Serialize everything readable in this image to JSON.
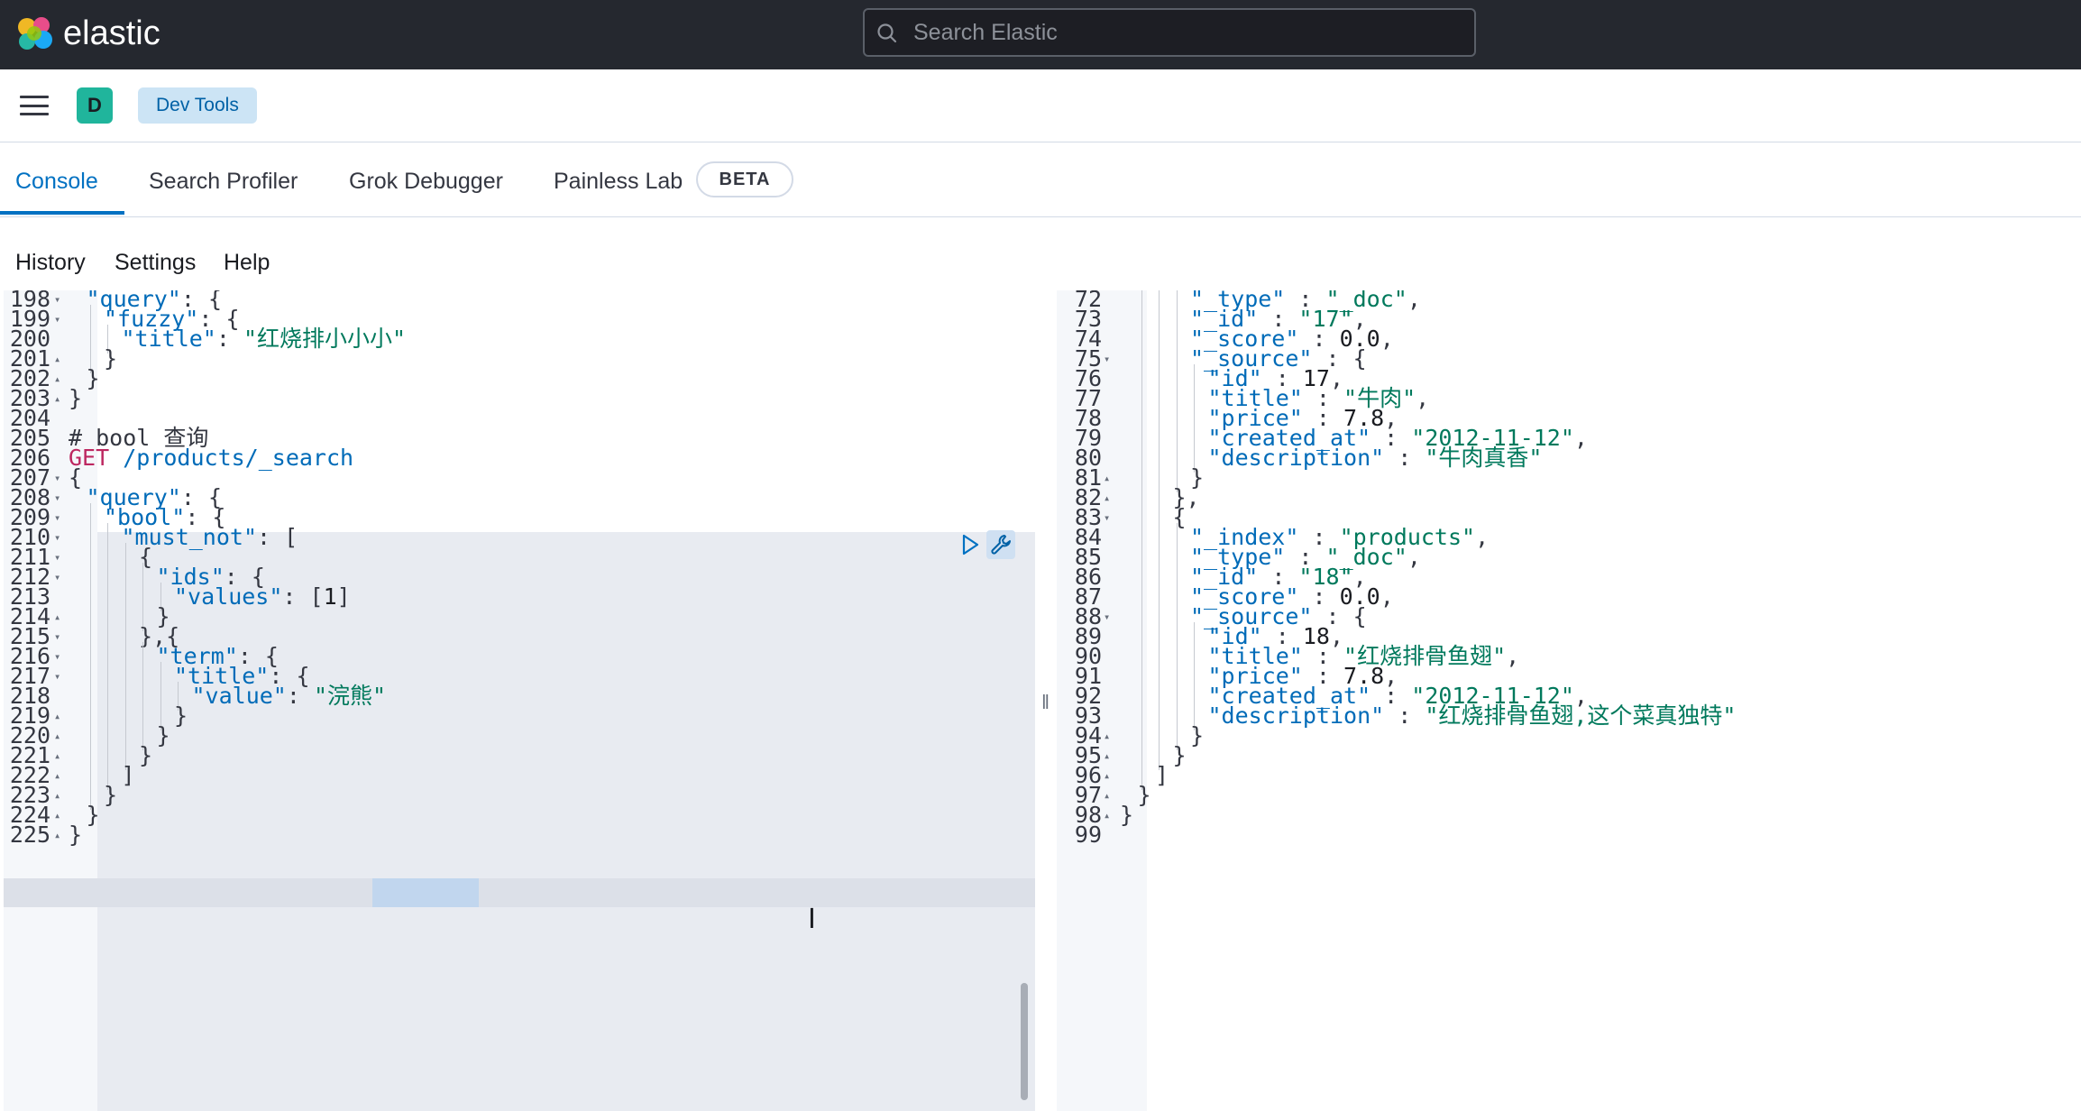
{
  "app": {
    "brand": "elastic",
    "search_placeholder": "Search Elastic"
  },
  "header": {
    "avatar_letter": "D",
    "breadcrumb": "Dev Tools"
  },
  "tabs": [
    {
      "label": "Console",
      "active": true
    },
    {
      "label": "Search Profiler"
    },
    {
      "label": "Grok Debugger"
    },
    {
      "label": "Painless Lab"
    }
  ],
  "beta_badge": "BETA",
  "menu": [
    "History",
    "Settings",
    "Help"
  ],
  "editor": {
    "lines": [
      {
        "n": "198",
        "fold": "down",
        "indent": 1,
        "parts": [
          [
            "k",
            "\"query\""
          ],
          [
            "p",
            ": {"
          ]
        ]
      },
      {
        "n": "199",
        "fold": "down",
        "indent": 2,
        "parts": [
          [
            "k",
            "\"fuzzy\""
          ],
          [
            "p",
            ": {"
          ]
        ]
      },
      {
        "n": "200",
        "indent": 3,
        "parts": [
          [
            "k",
            "\"title\""
          ],
          [
            "p",
            ": "
          ],
          [
            "s",
            "\"红烧排小小小\""
          ]
        ]
      },
      {
        "n": "201",
        "fold": "up",
        "indent": 2,
        "parts": [
          [
            "p",
            "}"
          ]
        ]
      },
      {
        "n": "202",
        "fold": "up",
        "indent": 1,
        "parts": [
          [
            "p",
            "}"
          ]
        ]
      },
      {
        "n": "203",
        "fold": "up",
        "indent": 0,
        "parts": [
          [
            "p",
            "}"
          ]
        ]
      },
      {
        "n": "204",
        "indent": 0,
        "parts": []
      },
      {
        "n": "205",
        "indent": 0,
        "parts": [
          [
            "c",
            "# bool 查询"
          ]
        ]
      },
      {
        "n": "206",
        "indent": 0,
        "parts": [
          [
            "m",
            "GET"
          ],
          [
            "p",
            " "
          ],
          [
            "k",
            "/products/_search"
          ]
        ]
      },
      {
        "n": "207",
        "fold": "down",
        "indent": 0,
        "parts": [
          [
            "p",
            "{"
          ]
        ]
      },
      {
        "n": "208",
        "fold": "down",
        "indent": 1,
        "parts": [
          [
            "k",
            "\"query\""
          ],
          [
            "p",
            ": {"
          ]
        ]
      },
      {
        "n": "209",
        "fold": "down",
        "indent": 2,
        "parts": [
          [
            "k",
            "\"bool\""
          ],
          [
            "p",
            ": {"
          ]
        ]
      },
      {
        "n": "210",
        "fold": "down",
        "indent": 3,
        "parts": [
          [
            "k",
            "\"must_not\""
          ],
          [
            "p",
            ": ["
          ]
        ]
      },
      {
        "n": "211",
        "fold": "down",
        "indent": 4,
        "parts": [
          [
            "p",
            "{"
          ]
        ]
      },
      {
        "n": "212",
        "fold": "down",
        "indent": 5,
        "parts": [
          [
            "k",
            "\"ids\""
          ],
          [
            "p",
            ": {"
          ]
        ]
      },
      {
        "n": "213",
        "indent": 6,
        "parts": [
          [
            "k",
            "\"values\""
          ],
          [
            "p",
            ": ["
          ],
          [
            "n",
            "1"
          ],
          [
            "p",
            "]"
          ]
        ]
      },
      {
        "n": "214",
        "fold": "up",
        "indent": 5,
        "parts": [
          [
            "p",
            "}"
          ]
        ]
      },
      {
        "n": "215",
        "fold": "down",
        "indent": 4,
        "parts": [
          [
            "p",
            "},{"
          ]
        ]
      },
      {
        "n": "216",
        "fold": "down",
        "indent": 5,
        "parts": [
          [
            "k",
            "\"term\""
          ],
          [
            "p",
            ": {"
          ]
        ]
      },
      {
        "n": "217",
        "fold": "down",
        "indent": 6,
        "parts": [
          [
            "k",
            "\"title\""
          ],
          [
            "p",
            ": {"
          ]
        ]
      },
      {
        "n": "218",
        "indent": 7,
        "parts": [
          [
            "k",
            "\"value\""
          ],
          [
            "p",
            ": "
          ],
          [
            "s",
            "\"浣熊\""
          ]
        ]
      },
      {
        "n": "219",
        "fold": "up",
        "indent": 6,
        "parts": [
          [
            "p",
            "}"
          ]
        ]
      },
      {
        "n": "220",
        "fold": "up",
        "indent": 5,
        "parts": [
          [
            "p",
            "}"
          ]
        ]
      },
      {
        "n": "221",
        "fold": "up",
        "indent": 4,
        "parts": [
          [
            "p",
            "}"
          ]
        ]
      },
      {
        "n": "222",
        "fold": "up",
        "indent": 3,
        "parts": [
          [
            "p",
            "]"
          ]
        ]
      },
      {
        "n": "223",
        "fold": "up",
        "indent": 2,
        "parts": [
          [
            "p",
            "}"
          ]
        ]
      },
      {
        "n": "224",
        "fold": "up",
        "indent": 1,
        "parts": [
          [
            "p",
            "}"
          ]
        ]
      },
      {
        "n": "225",
        "fold": "up",
        "indent": 0,
        "parts": [
          [
            "p",
            "}"
          ]
        ]
      }
    ]
  },
  "output": {
    "lines": [
      {
        "n": "72",
        "indent": 4,
        "parts": [
          [
            "k",
            "\"_type\""
          ],
          [
            "p",
            " : "
          ],
          [
            "s",
            "\"_doc\""
          ],
          [
            "p",
            ","
          ]
        ]
      },
      {
        "n": "73",
        "indent": 4,
        "parts": [
          [
            "k",
            "\"_id\""
          ],
          [
            "p",
            " : "
          ],
          [
            "s",
            "\"17\""
          ],
          [
            "p",
            ","
          ]
        ]
      },
      {
        "n": "74",
        "indent": 4,
        "parts": [
          [
            "k",
            "\"_score\""
          ],
          [
            "p",
            " : "
          ],
          [
            "n",
            "0.0"
          ],
          [
            "p",
            ","
          ]
        ]
      },
      {
        "n": "75",
        "fold": "down",
        "indent": 4,
        "parts": [
          [
            "k",
            "\"_source\""
          ],
          [
            "p",
            " : {"
          ]
        ]
      },
      {
        "n": "76",
        "indent": 5,
        "parts": [
          [
            "k",
            "\"id\""
          ],
          [
            "p",
            " : "
          ],
          [
            "n",
            "17"
          ],
          [
            "p",
            ","
          ]
        ]
      },
      {
        "n": "77",
        "indent": 5,
        "parts": [
          [
            "k",
            "\"title\""
          ],
          [
            "p",
            " : "
          ],
          [
            "s",
            "\"牛肉\""
          ],
          [
            "p",
            ","
          ]
        ]
      },
      {
        "n": "78",
        "indent": 5,
        "parts": [
          [
            "k",
            "\"price\""
          ],
          [
            "p",
            " : "
          ],
          [
            "n",
            "7.8"
          ],
          [
            "p",
            ","
          ]
        ]
      },
      {
        "n": "79",
        "indent": 5,
        "parts": [
          [
            "k",
            "\"created_at\""
          ],
          [
            "p",
            " : "
          ],
          [
            "s",
            "\"2012-11-12\""
          ],
          [
            "p",
            ","
          ]
        ]
      },
      {
        "n": "80",
        "indent": 5,
        "parts": [
          [
            "k",
            "\"description\""
          ],
          [
            "p",
            " : "
          ],
          [
            "s",
            "\"牛肉真香\""
          ]
        ]
      },
      {
        "n": "81",
        "fold": "up",
        "indent": 4,
        "parts": [
          [
            "p",
            "}"
          ]
        ]
      },
      {
        "n": "82",
        "fold": "up",
        "indent": 3,
        "parts": [
          [
            "p",
            "},"
          ]
        ]
      },
      {
        "n": "83",
        "fold": "down",
        "indent": 3,
        "parts": [
          [
            "p",
            "{"
          ]
        ]
      },
      {
        "n": "84",
        "indent": 4,
        "parts": [
          [
            "k",
            "\"_index\""
          ],
          [
            "p",
            " : "
          ],
          [
            "s",
            "\"products\""
          ],
          [
            "p",
            ","
          ]
        ]
      },
      {
        "n": "85",
        "indent": 4,
        "parts": [
          [
            "k",
            "\"_type\""
          ],
          [
            "p",
            " : "
          ],
          [
            "s",
            "\"_doc\""
          ],
          [
            "p",
            ","
          ]
        ]
      },
      {
        "n": "86",
        "indent": 4,
        "parts": [
          [
            "k",
            "\"_id\""
          ],
          [
            "p",
            " : "
          ],
          [
            "s",
            "\"18\""
          ],
          [
            "p",
            ","
          ]
        ]
      },
      {
        "n": "87",
        "indent": 4,
        "parts": [
          [
            "k",
            "\"_score\""
          ],
          [
            "p",
            " : "
          ],
          [
            "n",
            "0.0"
          ],
          [
            "p",
            ","
          ]
        ]
      },
      {
        "n": "88",
        "fold": "down",
        "indent": 4,
        "parts": [
          [
            "k",
            "\"_source\""
          ],
          [
            "p",
            " : {"
          ]
        ]
      },
      {
        "n": "89",
        "indent": 5,
        "parts": [
          [
            "k",
            "\"id\""
          ],
          [
            "p",
            " : "
          ],
          [
            "n",
            "18"
          ],
          [
            "p",
            ","
          ]
        ]
      },
      {
        "n": "90",
        "indent": 5,
        "parts": [
          [
            "k",
            "\"title\""
          ],
          [
            "p",
            " : "
          ],
          [
            "s",
            "\"红烧排骨鱼翅\""
          ],
          [
            "p",
            ","
          ]
        ]
      },
      {
        "n": "91",
        "indent": 5,
        "parts": [
          [
            "k",
            "\"price\""
          ],
          [
            "p",
            " : "
          ],
          [
            "n",
            "7.8"
          ],
          [
            "p",
            ","
          ]
        ]
      },
      {
        "n": "92",
        "indent": 5,
        "parts": [
          [
            "k",
            "\"created_at\""
          ],
          [
            "p",
            " : "
          ],
          [
            "s",
            "\"2012-11-12\""
          ],
          [
            "p",
            ","
          ]
        ]
      },
      {
        "n": "93",
        "indent": 5,
        "parts": [
          [
            "k",
            "\"description\""
          ],
          [
            "p",
            " : "
          ],
          [
            "s",
            "\"红烧排骨鱼翅,这个菜真独特\""
          ]
        ]
      },
      {
        "n": "94",
        "fold": "up",
        "indent": 4,
        "parts": [
          [
            "p",
            "}"
          ]
        ]
      },
      {
        "n": "95",
        "fold": "up",
        "indent": 3,
        "parts": [
          [
            "p",
            "}"
          ]
        ]
      },
      {
        "n": "96",
        "fold": "up",
        "indent": 2,
        "parts": [
          [
            "p",
            "]"
          ]
        ]
      },
      {
        "n": "97",
        "fold": "up",
        "indent": 1,
        "parts": [
          [
            "p",
            "}"
          ]
        ]
      },
      {
        "n": "98",
        "fold": "up",
        "indent": 0,
        "parts": [
          [
            "p",
            "}"
          ]
        ]
      },
      {
        "n": "99",
        "indent": 0,
        "parts": []
      }
    ]
  }
}
